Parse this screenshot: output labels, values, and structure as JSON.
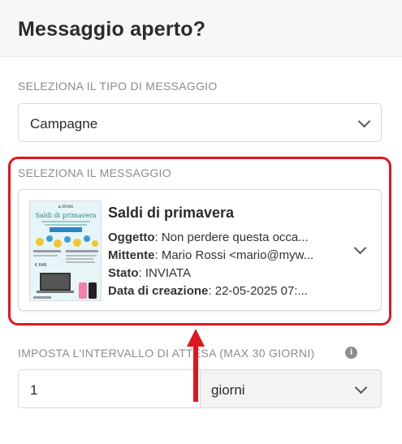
{
  "header": {
    "title": "Messaggio aperto?"
  },
  "message_type": {
    "label": "SELEZIONA IL TIPO DI MESSAGGIO",
    "selected": "Campagne"
  },
  "message": {
    "label": "SELEZIONA IL MESSAGGIO",
    "card": {
      "title": "Saldi di primavera",
      "subject_key": "Oggetto",
      "subject_value": ": Non perdere questa occa...",
      "sender_key": "Mittente",
      "sender_value": ": Mario Rossi <mario@myw...",
      "status_key": "Stato",
      "status_value": ": INVIATA",
      "created_key": "Data di creazione",
      "created_value": ": 22-05-2025 07:...",
      "thumbnail": {
        "headline": "Saldi di primavera",
        "price": "€ 649"
      }
    }
  },
  "interval": {
    "label": "IMPOSTA L'INTERVALLO DI ATTESA (MAX 30 GIORNI)",
    "value": "1",
    "unit": "giorni"
  },
  "colors": {
    "highlight": "#e0161f",
    "label_gray": "#8c8c8c"
  },
  "icons": [
    "chevron-down-icon",
    "info-icon",
    "arrow-up-icon"
  ]
}
